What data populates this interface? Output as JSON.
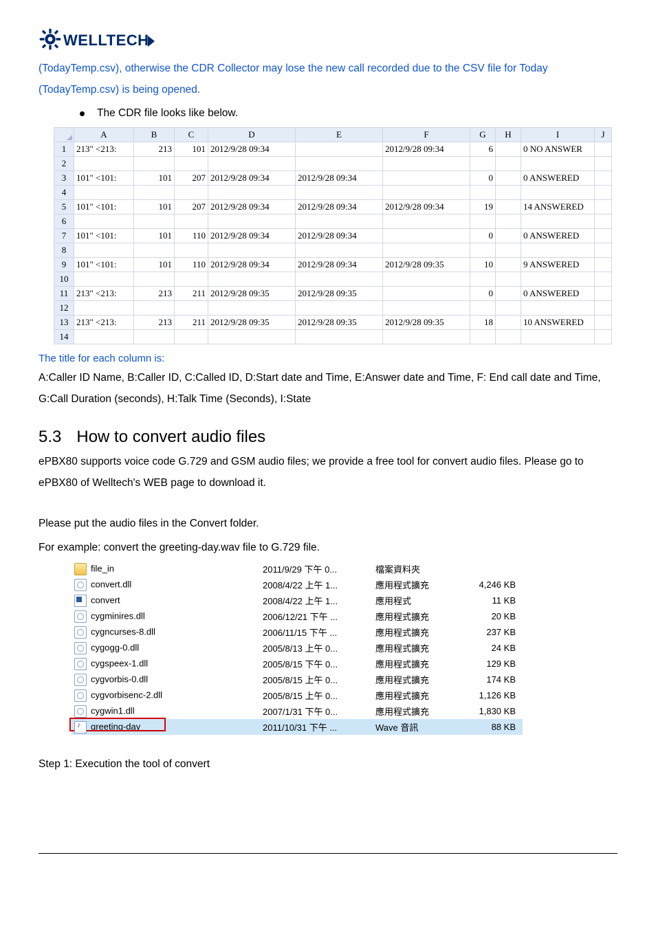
{
  "logo": {
    "text": "WELLTECH"
  },
  "intro": "(TodayTemp.csv), otherwise the CDR Collector may lose the new call recorded due to the CSV file for Today (TodayTemp.csv) is being opened.",
  "bullet": "The CDR file looks like below.",
  "sheet": {
    "cols": [
      "A",
      "B",
      "C",
      "D",
      "E",
      "F",
      "G",
      "H",
      "I",
      "J"
    ],
    "widths": [
      80,
      52,
      42,
      120,
      120,
      120,
      30,
      30,
      100,
      18
    ],
    "rows": [
      {
        "n": "1",
        "cells": [
          "213\" <213:",
          "213",
          "101",
          "2012/9/28 09:34",
          "",
          "2012/9/28 09:34",
          "6",
          "",
          "0 NO ANSWER",
          ""
        ]
      },
      {
        "n": "2",
        "cells": [
          "",
          "",
          "",
          "",
          "",
          "",
          "",
          "",
          "",
          ""
        ]
      },
      {
        "n": "3",
        "cells": [
          "101\" <101:",
          "101",
          "207",
          "2012/9/28 09:34",
          "2012/9/28 09:34",
          "",
          "0",
          "",
          "0 ANSWERED",
          ""
        ]
      },
      {
        "n": "4",
        "cells": [
          "",
          "",
          "",
          "",
          "",
          "",
          "",
          "",
          "",
          ""
        ]
      },
      {
        "n": "5",
        "cells": [
          "101\" <101:",
          "101",
          "207",
          "2012/9/28 09:34",
          "2012/9/28 09:34",
          "2012/9/28 09:34",
          "19",
          "",
          "14 ANSWERED",
          ""
        ]
      },
      {
        "n": "6",
        "cells": [
          "",
          "",
          "",
          "",
          "",
          "",
          "",
          "",
          "",
          ""
        ]
      },
      {
        "n": "7",
        "cells": [
          "101\" <101:",
          "101",
          "110",
          "2012/9/28 09:34",
          "2012/9/28 09:34",
          "",
          "0",
          "",
          "0 ANSWERED",
          ""
        ]
      },
      {
        "n": "8",
        "cells": [
          "",
          "",
          "",
          "",
          "",
          "",
          "",
          "",
          "",
          ""
        ]
      },
      {
        "n": "9",
        "cells": [
          "101\" <101:",
          "101",
          "110",
          "2012/9/28 09:34",
          "2012/9/28 09:34",
          "2012/9/28 09:35",
          "10",
          "",
          "9 ANSWERED",
          ""
        ]
      },
      {
        "n": "10",
        "cells": [
          "",
          "",
          "",
          "",
          "",
          "",
          "",
          "",
          "",
          ""
        ]
      },
      {
        "n": "11",
        "cells": [
          "213\" <213:",
          "213",
          "211",
          "2012/9/28 09:35",
          "2012/9/28 09:35",
          "",
          "0",
          "",
          "0 ANSWERED",
          ""
        ]
      },
      {
        "n": "12",
        "cells": [
          "",
          "",
          "",
          "",
          "",
          "",
          "",
          "",
          "",
          ""
        ]
      },
      {
        "n": "13",
        "cells": [
          "213\" <213:",
          "213",
          "211",
          "2012/9/28 09:35",
          "2012/9/28 09:35",
          "2012/9/28 09:35",
          "18",
          "",
          "10 ANSWERED",
          ""
        ]
      },
      {
        "n": "14",
        "cells": [
          "",
          "",
          "",
          "",
          "",
          "",
          "",
          "",
          "",
          ""
        ]
      }
    ]
  },
  "col_title_head": "The title for each column is:",
  "col_title_body": "A:Caller ID Name, B:Caller ID, C:Called ID, D:Start date and Time, E:Answer date and Time, F: End call date and Time, G:Call Duration (seconds), H:Talk Time (Seconds), I:State",
  "section": {
    "num": "5.3",
    "title": "How to convert audio files"
  },
  "section_body1": "ePBX80 supports voice code G.729 and GSM audio files; we provide a free tool for convert audio files. Please go to ePBX80 of Welltech's WEB page to download it.",
  "section_body2": "Please put the audio files in the Convert folder.",
  "section_body3": "For example: convert the greeting-day.wav file to G.729 file.",
  "files": [
    {
      "icon": "folder",
      "name": "file_in",
      "date": "2011/9/29 下午 0...",
      "type": "檔案資料夾",
      "size": ""
    },
    {
      "icon": "gear",
      "name": "convert.dll",
      "date": "2008/4/22 上午 1...",
      "type": "應用程式擴充",
      "size": "4,246 KB"
    },
    {
      "icon": "exe",
      "name": "convert",
      "date": "2008/4/22 上午 1...",
      "type": "應用程式",
      "size": "11 KB"
    },
    {
      "icon": "gear",
      "name": "cygminires.dll",
      "date": "2006/12/21 下午 ...",
      "type": "應用程式擴充",
      "size": "20 KB"
    },
    {
      "icon": "gear",
      "name": "cygncurses-8.dll",
      "date": "2006/11/15 下午 ...",
      "type": "應用程式擴充",
      "size": "237 KB"
    },
    {
      "icon": "gear",
      "name": "cygogg-0.dll",
      "date": "2005/8/13 上午 0...",
      "type": "應用程式擴充",
      "size": "24 KB"
    },
    {
      "icon": "gear",
      "name": "cygspeex-1.dll",
      "date": "2005/8/15 下午 0...",
      "type": "應用程式擴充",
      "size": "129 KB"
    },
    {
      "icon": "gear",
      "name": "cygvorbis-0.dll",
      "date": "2005/8/15 上午 0...",
      "type": "應用程式擴充",
      "size": "174 KB"
    },
    {
      "icon": "gear",
      "name": "cygvorbisenc-2.dll",
      "date": "2005/8/15 上午 0...",
      "type": "應用程式擴充",
      "size": "1,126 KB"
    },
    {
      "icon": "gear",
      "name": "cygwin1.dll",
      "date": "2007/1/31 下午 0...",
      "type": "應用程式擴充",
      "size": "1,830 KB"
    },
    {
      "icon": "audio",
      "name": "greeting-day",
      "date": "2011/10/31 下午 ...",
      "type": "Wave 音訊",
      "size": "88 KB",
      "selected": true,
      "boxed": true
    }
  ],
  "step": "Step 1: Execution the tool of convert"
}
